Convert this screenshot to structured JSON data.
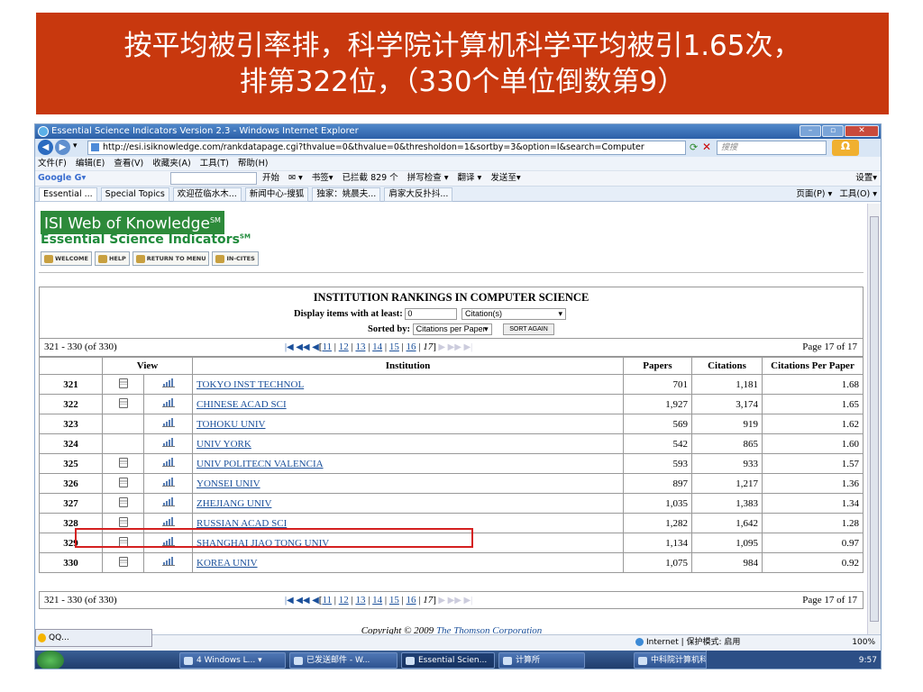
{
  "slide": {
    "title_line1": "按平均被引率排，科学院计算机科学平均被引1.65次，",
    "title_line2": "排第322位，（330个单位倒数第9）"
  },
  "window": {
    "title": "Essential Science Indicators Version 2.3 - Windows Internet Explorer",
    "url": "http://esi.isiknowledge.com/rankdatapage.cgi?thvalue=0&thvalue=0&thresholdon=1&sortby=3&option=I&search=Computer",
    "search_placeholder": "搜搜",
    "menu": [
      "文件(F)",
      "编辑(E)",
      "查看(V)",
      "收藏夹(A)",
      "工具(T)",
      "帮助(H)"
    ],
    "google_logo": "Google G▾",
    "google_items": [
      "开始",
      "✉ ▾",
      "书签▾",
      "已拦截 829 个",
      "拼写检查 ▾",
      "翻译 ▾",
      "发送至▾"
    ],
    "google_right": [
      "设置▾"
    ],
    "fav_tabs": [
      "Essential ...",
      "Special Topics",
      "欢迎莅临水木...",
      "新闻中心-搜狐",
      "独家：姚晨夫...",
      "肩家大反扑抖..."
    ],
    "fav_right": [
      "页面(P) ▾",
      "工具(O) ▾"
    ],
    "status_zone": "Internet | 保护模式: 启用",
    "status_zoom": "100%",
    "qq_label": "QQ...",
    "taskbar": [
      "4 Windows L... ▾",
      "已发送邮件 - W...",
      "Essential Scien...",
      "计算所",
      "中科院计算机科..."
    ],
    "clock": "9:57"
  },
  "esi": {
    "isi_title": "ISI Web of Knowledge",
    "isi_sm": "SM",
    "esi_title": "Essential Science Indicators",
    "esi_sm": "SM",
    "buttons": [
      "WELCOME",
      "HELP",
      "RETURN TO MENU",
      "IN-CITES"
    ]
  },
  "table": {
    "title": "INSTITUTION RANKINGS IN COMPUTER SCIENCE",
    "display_label": "Display items with at least:",
    "display_value": "0",
    "display_unit": "Citation(s)",
    "sorted_label": "Sorted by:",
    "sorted_value": "Citations per Paper",
    "sort_again": "SORT AGAIN",
    "range": "321 - 330 (of 330)",
    "page": "Page 17 of 17",
    "pager_links": [
      "11",
      "12",
      "13",
      "14",
      "15",
      "16"
    ],
    "pager_current": "17",
    "columns": [
      "View",
      "Institution",
      "Papers",
      "Citations",
      "Citations Per Paper"
    ],
    "rows": [
      {
        "rank": "321",
        "doc": true,
        "institution": "TOKYO INST TECHNOL",
        "papers": "701",
        "citations": "1,181",
        "cpp": "1.68"
      },
      {
        "rank": "322",
        "doc": true,
        "institution": "CHINESE ACAD SCI",
        "papers": "1,927",
        "citations": "3,174",
        "cpp": "1.65"
      },
      {
        "rank": "323",
        "doc": false,
        "institution": "TOHOKU UNIV",
        "papers": "569",
        "citations": "919",
        "cpp": "1.62"
      },
      {
        "rank": "324",
        "doc": false,
        "institution": "UNIV YORK",
        "papers": "542",
        "citations": "865",
        "cpp": "1.60"
      },
      {
        "rank": "325",
        "doc": true,
        "institution": "UNIV POLITECN VALENCIA",
        "papers": "593",
        "citations": "933",
        "cpp": "1.57"
      },
      {
        "rank": "326",
        "doc": true,
        "institution": "YONSEI UNIV",
        "papers": "897",
        "citations": "1,217",
        "cpp": "1.36"
      },
      {
        "rank": "327",
        "doc": true,
        "institution": "ZHEJIANG UNIV",
        "papers": "1,035",
        "citations": "1,383",
        "cpp": "1.34"
      },
      {
        "rank": "328",
        "doc": true,
        "institution": "RUSSIAN ACAD SCI",
        "papers": "1,282",
        "citations": "1,642",
        "cpp": "1.28"
      },
      {
        "rank": "329",
        "doc": true,
        "institution": "SHANGHAI JIAO TONG UNIV",
        "papers": "1,134",
        "citations": "1,095",
        "cpp": "0.97"
      },
      {
        "rank": "330",
        "doc": true,
        "institution": "KOREA UNIV",
        "papers": "1,075",
        "citations": "984",
        "cpp": "0.92"
      }
    ],
    "copyright_prefix": "Copyright © 2009",
    "copyright_link": "The Thomson Corporation"
  },
  "colors": {
    "banner": "#c8380e",
    "highlight": "#d42020",
    "link": "#1a4f9a",
    "isi_green": "#2d8a3a"
  }
}
